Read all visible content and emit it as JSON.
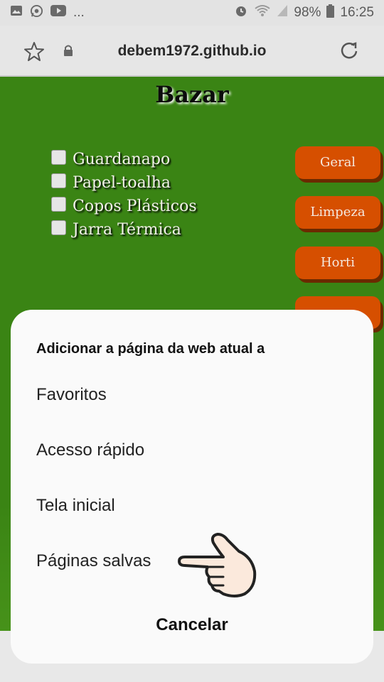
{
  "statusbar": {
    "notification_icons": [
      "gallery-icon",
      "whatsapp-icon",
      "youtube-icon"
    ],
    "more": "...",
    "battery": "98%",
    "time": "16:25"
  },
  "urlbar": {
    "url": "debem1972.github.io"
  },
  "page": {
    "title": "Bazar",
    "items": [
      "Guardanapo",
      "Papel-toalha",
      "Copos Plásticos",
      "Jarra Térmica"
    ],
    "categories": [
      "Geral",
      "Limpeza",
      "Horti"
    ],
    "colors": {
      "background": "#3a8414",
      "button": "#d64f00"
    }
  },
  "sheet": {
    "title": "Adicionar a página da web atual a",
    "options": [
      "Favoritos",
      "Acesso rápido",
      "Tela inicial",
      "Páginas salvas"
    ],
    "cancel": "Cancelar"
  }
}
